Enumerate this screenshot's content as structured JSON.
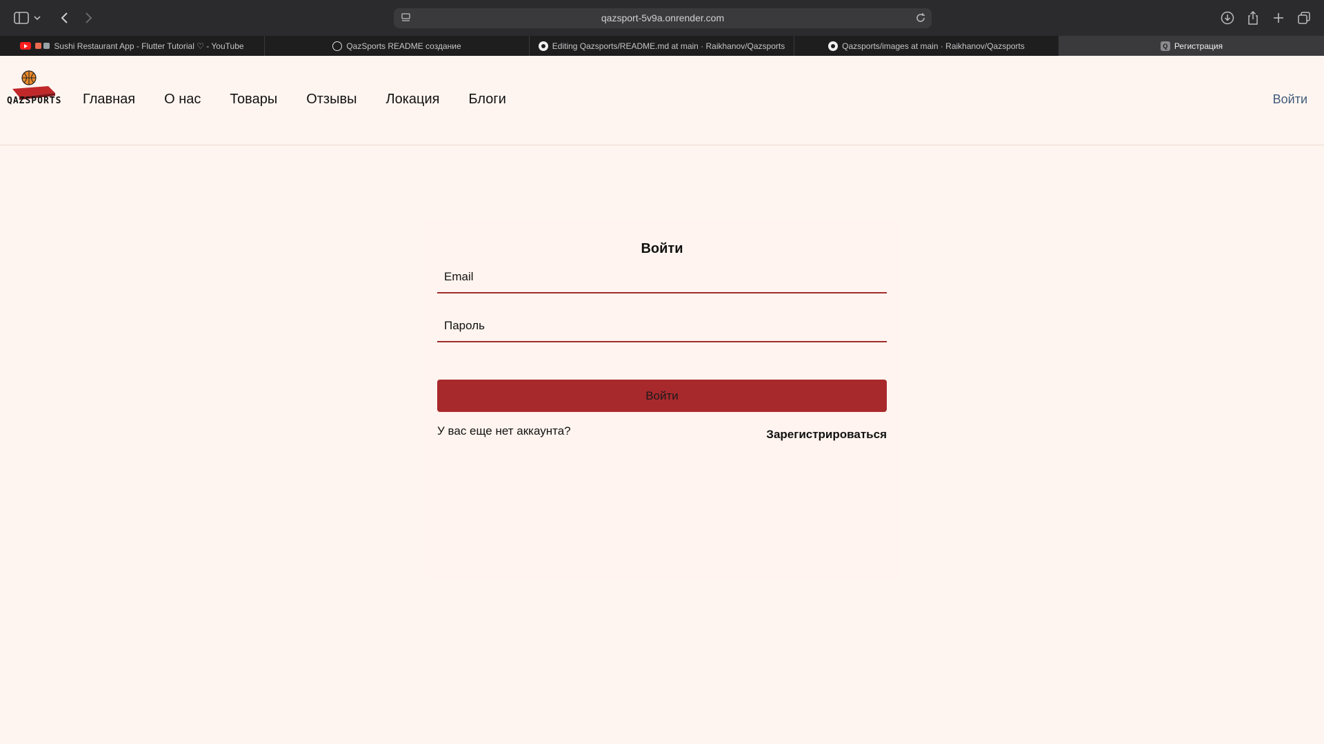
{
  "browser": {
    "url": "qazsport-5v9a.onrender.com",
    "tabs": [
      {
        "label": "Sushi Restaurant App - Flutter Tutorial ♡ - YouTube",
        "icon": "youtube-icon"
      },
      {
        "label": "QazSports README создание",
        "icon": "chatgpt-icon"
      },
      {
        "label": "Editing Qazsports/README.md at main · Raikhanov/Qazsports",
        "icon": "github-icon"
      },
      {
        "label": "Qazsports/images at main · Raikhanov/Qazsports",
        "icon": "github-icon"
      },
      {
        "label": "Регистрация",
        "icon": "site-icon",
        "fav_letter": "Q"
      }
    ]
  },
  "header": {
    "logo_text": "QAZSPORTS",
    "nav": [
      "Главная",
      "О нас",
      "Товары",
      "Отзывы",
      "Локация",
      "Блоги"
    ],
    "login_link": "Войти"
  },
  "form": {
    "title": "Войти",
    "email_placeholder": "Email",
    "password_placeholder": "Пароль",
    "submit_label": "Войти",
    "no_account_text": "У вас еще нет аккаунта?",
    "register_link": "Зарегистрироваться"
  },
  "colors": {
    "accent": "#a8292c",
    "background": "#fff5f0",
    "link": "#3f5a7a"
  }
}
